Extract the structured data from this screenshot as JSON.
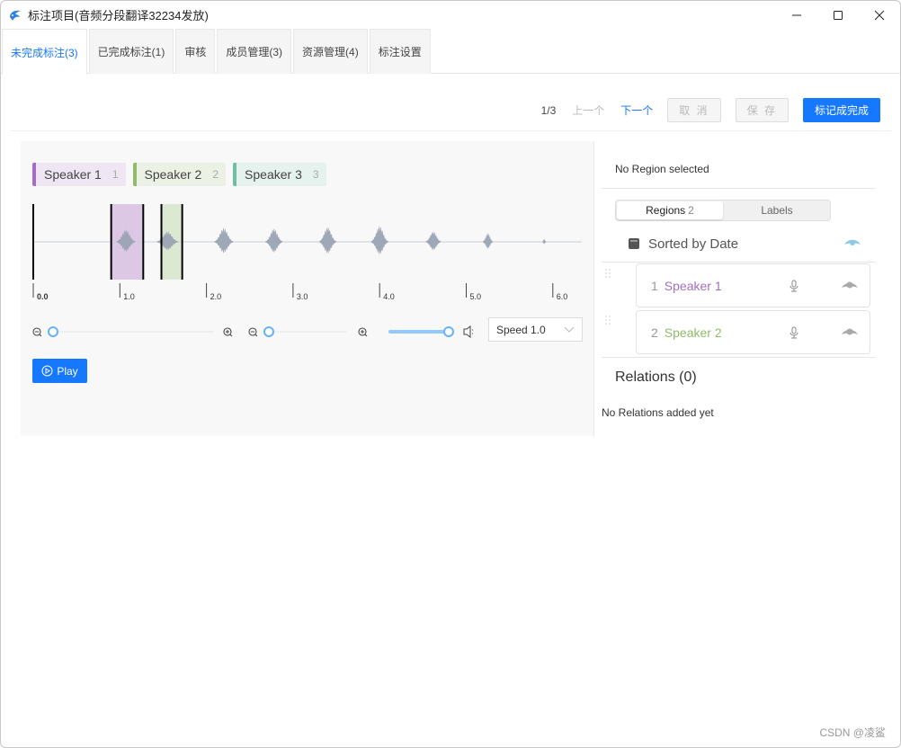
{
  "window": {
    "title": "标注项目(音频分段翻译32234发放)",
    "controls": [
      "minimize",
      "maximize",
      "close"
    ]
  },
  "tabs": [
    {
      "label": "未完成标注(3)",
      "active": true
    },
    {
      "label": "已完成标注(1)",
      "active": false
    },
    {
      "label": "审核",
      "active": false
    },
    {
      "label": "成员管理(3)",
      "active": false
    },
    {
      "label": "资源管理(4)",
      "active": false
    },
    {
      "label": "标注设置",
      "active": false
    }
  ],
  "toolbar": {
    "pager": "1/3",
    "prev_label": "上一个",
    "next_label": "下一个",
    "cancel_label": "取 消",
    "save_label": "保 存",
    "complete_label": "标记成完成"
  },
  "labels": [
    {
      "name": "Speaker 1",
      "hotkey": "1",
      "color": "#a46fc0",
      "bg": "#efe6f3"
    },
    {
      "name": "Speaker 2",
      "hotkey": "2",
      "color": "#8fbc6a",
      "bg": "#ebf2e5"
    },
    {
      "name": "Speaker 3",
      "hotkey": "3",
      "color": "#6fbfa6",
      "bg": "#e5f2ee"
    }
  ],
  "waveform": {
    "timeline_ticks": [
      "0.0",
      "1.0",
      "2.0",
      "3.0",
      "4.0",
      "5.0",
      "6.0"
    ],
    "duration_seconds": 6.3,
    "regions": [
      {
        "label": "Speaker 1",
        "start": 0.9,
        "end": 1.27,
        "color": "#dcc8e4"
      },
      {
        "label": "Speaker 2",
        "start": 1.48,
        "end": 1.72,
        "color": "#dde8d2"
      }
    ],
    "bursts": [
      {
        "center": 1.07,
        "width": 0.22,
        "amp": 0.35
      },
      {
        "center": 1.55,
        "width": 0.25,
        "amp": 0.3
      },
      {
        "center": 2.2,
        "width": 0.22,
        "amp": 0.4
      },
      {
        "center": 2.78,
        "width": 0.2,
        "amp": 0.38
      },
      {
        "center": 3.4,
        "width": 0.2,
        "amp": 0.42
      },
      {
        "center": 4.0,
        "width": 0.2,
        "amp": 0.45
      },
      {
        "center": 4.62,
        "width": 0.18,
        "amp": 0.3
      },
      {
        "center": 5.25,
        "width": 0.12,
        "amp": 0.25
      },
      {
        "center": 5.9,
        "width": 0.05,
        "amp": 0.08
      }
    ],
    "wave_color": "#9aa3b3"
  },
  "controls": {
    "zoom_value": 0,
    "zoom2_value": 0,
    "volume_value": 1.0,
    "speed_label": "Speed 1.0",
    "play_label": "Play"
  },
  "sidebar": {
    "no_region": "No Region selected",
    "tab_regions": "Regions",
    "regions_count": "2",
    "tab_labels": "Labels",
    "sort_label": "Sorted by Date",
    "regions": [
      {
        "index": "1",
        "label": "Speaker 1",
        "color": "#a46fc0"
      },
      {
        "index": "2",
        "label": "Speaker 2",
        "color": "#8fbc6a"
      }
    ],
    "relations_title": "Relations (0)",
    "no_relations": "No Relations added yet"
  },
  "watermark": "CSDN @凌鲨"
}
